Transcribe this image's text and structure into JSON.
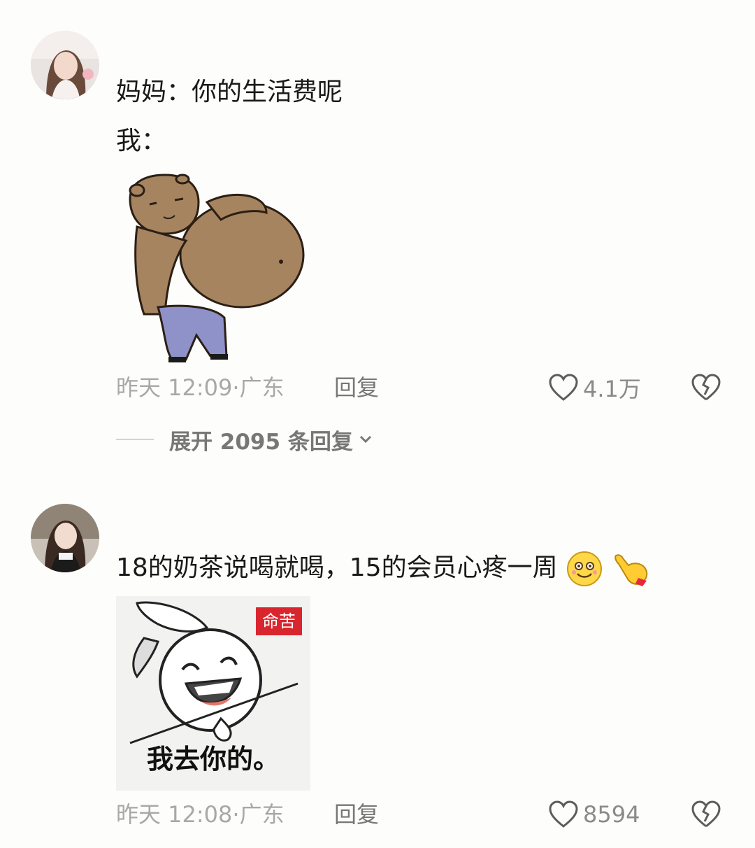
{
  "comments": [
    {
      "lines": [
        "妈妈：你的生活费呢",
        "我："
      ],
      "timestamp": "昨天 12:09·广东",
      "reply_label": "回复",
      "likes": "4.1万",
      "expand_label": "展开 2095 条回复"
    },
    {
      "lines": [
        "18的奶茶说喝就喝，15的会员心疼一周"
      ],
      "sticker_text": "我去你的。",
      "sticker_stamp": "命苦",
      "timestamp": "昨天 12:08·广东",
      "reply_label": "回复",
      "likes": "8594"
    }
  ],
  "icons": {
    "like": "heart-outline-icon",
    "dislike": "broken-heart-icon",
    "expand": "chevron-down-icon"
  },
  "colors": {
    "background": "#fdfdfb",
    "meta_text": "#a8a8a8",
    "stamp_red": "#d9262e"
  }
}
